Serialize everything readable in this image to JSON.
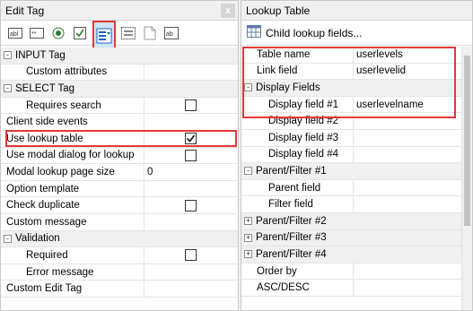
{
  "left": {
    "title": "Edit Tag",
    "close_label": "x",
    "toolbar_icons": [
      "text-box-icon",
      "password-box-icon",
      "radio-button-icon",
      "checkbox-icon",
      "select-list-icon",
      "hidden-field-icon",
      "file-icon",
      "textarea-icon"
    ],
    "rows": [
      {
        "type": "category",
        "label": "INPUT Tag",
        "expander": "-"
      },
      {
        "type": "prop",
        "label": "Custom attributes",
        "value": "",
        "indent": true
      },
      {
        "type": "category",
        "label": "SELECT Tag",
        "expander": "-"
      },
      {
        "type": "prop",
        "label": "Requires search",
        "value": "",
        "indent": true,
        "checkbox": false
      },
      {
        "type": "prop",
        "label": "Client side events",
        "value": ""
      },
      {
        "type": "prop",
        "label": "Use lookup table",
        "value": "",
        "checkbox": true
      },
      {
        "type": "prop",
        "label": "Use modal dialog for lookup",
        "value": "",
        "checkbox": false
      },
      {
        "type": "prop",
        "label": "Modal lookup page size",
        "value": "0"
      },
      {
        "type": "prop",
        "label": "Option template",
        "value": ""
      },
      {
        "type": "prop",
        "label": "Check duplicate",
        "value": "",
        "checkbox": false
      },
      {
        "type": "prop",
        "label": "Custom message",
        "value": ""
      },
      {
        "type": "category",
        "label": "Validation",
        "expander": "-"
      },
      {
        "type": "prop",
        "label": "Required",
        "value": "",
        "indent": true,
        "checkbox": false
      },
      {
        "type": "prop",
        "label": "Error message",
        "value": "",
        "indent": true
      },
      {
        "type": "prop",
        "label": "Custom Edit Tag",
        "value": ""
      }
    ]
  },
  "right": {
    "title": "Lookup Table",
    "child_lookup_label": "Child lookup fields...",
    "rows": [
      {
        "type": "prop",
        "label": "Table name",
        "value": "userlevels",
        "top": true
      },
      {
        "type": "prop",
        "label": "Link field",
        "value": "userlevelid",
        "top": true
      },
      {
        "type": "category",
        "label": "Display Fields",
        "expander": "-"
      },
      {
        "type": "prop",
        "label": "Display field #1",
        "value": "userlevelname",
        "indent": true
      },
      {
        "type": "prop",
        "label": "Display field #2",
        "value": "",
        "indent": true
      },
      {
        "type": "prop",
        "label": "Display field #3",
        "value": "",
        "indent": true
      },
      {
        "type": "prop",
        "label": "Display field #4",
        "value": "",
        "indent": true
      },
      {
        "type": "category",
        "label": "Parent/Filter #1",
        "expander": "-"
      },
      {
        "type": "prop",
        "label": "Parent field",
        "value": "",
        "indent": true
      },
      {
        "type": "prop",
        "label": "Filter field",
        "value": "",
        "indent": true
      },
      {
        "type": "category",
        "label": "Parent/Filter #2",
        "expander": "+"
      },
      {
        "type": "category",
        "label": "Parent/Filter #3",
        "expander": "+"
      },
      {
        "type": "category",
        "label": "Parent/Filter #4",
        "expander": "+"
      },
      {
        "type": "prop",
        "label": "Order by",
        "value": "",
        "top": true
      },
      {
        "type": "prop",
        "label": "ASC/DESC",
        "value": "",
        "top": true
      }
    ]
  },
  "colors": {
    "highlight": "#e53935",
    "category_bg": "#f0f0f0",
    "selected_tool_bg": "#cde6f7"
  }
}
